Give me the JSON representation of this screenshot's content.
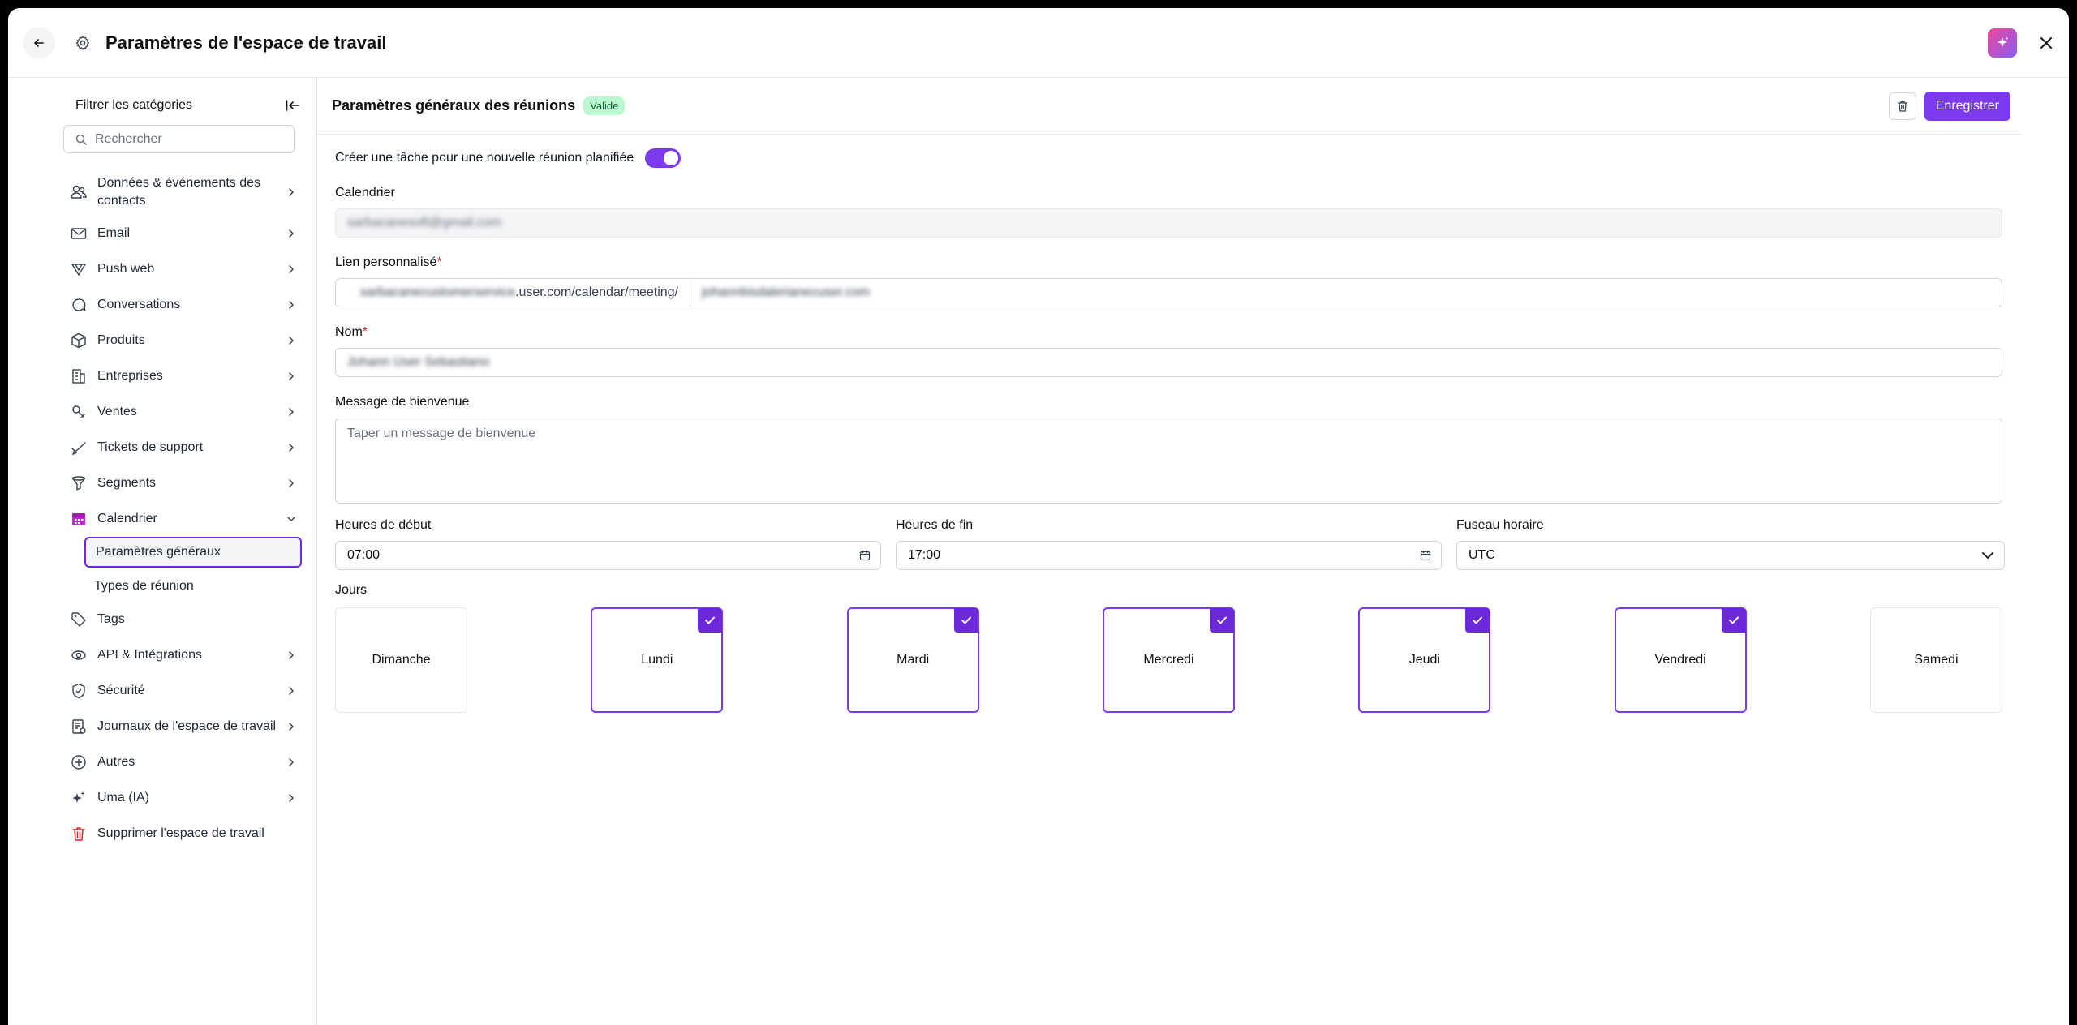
{
  "header": {
    "title": "Paramètres de l'espace de travail"
  },
  "sidebar": {
    "filter_title": "Filtrer les catégories",
    "search_placeholder": "Rechercher",
    "items": [
      {
        "label": "Données & événements des contacts",
        "icon": "contacts-icon"
      },
      {
        "label": "Email",
        "icon": "mail-icon"
      },
      {
        "label": "Push web",
        "icon": "push-icon"
      },
      {
        "label": "Conversations",
        "icon": "chat-icon"
      },
      {
        "label": "Produits",
        "icon": "box-icon"
      },
      {
        "label": "Entreprises",
        "icon": "building-icon"
      },
      {
        "label": "Ventes",
        "icon": "sales-icon"
      },
      {
        "label": "Tickets de support",
        "icon": "ticket-icon"
      },
      {
        "label": "Segments",
        "icon": "filter-icon"
      },
      {
        "label": "Calendrier",
        "icon": "calendar-icon"
      },
      {
        "label": "Tags",
        "icon": "tag-icon"
      },
      {
        "label": "API & Intégrations",
        "icon": "api-icon"
      },
      {
        "label": "Sécurité",
        "icon": "shield-icon"
      },
      {
        "label": "Journaux de l'espace de travail",
        "icon": "log-icon"
      },
      {
        "label": "Autres",
        "icon": "others-icon"
      },
      {
        "label": "Uma (IA)",
        "icon": "sparkle-icon"
      },
      {
        "label": "Supprimer l'espace de travail",
        "icon": "trash-icon"
      }
    ],
    "calendar_sub": [
      "Paramètres généraux",
      "Types de réunion"
    ]
  },
  "main": {
    "title": "Paramètres généraux des réunions",
    "badge": "Valide",
    "save_label": "Enregistrer",
    "toggle_label": "Créer une tâche pour une nouvelle réunion planifiée",
    "toggle_on": true,
    "calendar_label": "Calendrier",
    "calendar_value": "sarbacanesoft@gmail.com",
    "link_label": "Lien personnalisé",
    "link_prefix_hidden": "sarbacanecustomerservice",
    "link_prefix": ".user.com/calendar/meeting/",
    "link_slug": "johannbisdalerianecuser.com",
    "name_label": "Nom",
    "name_value": "Johann User Sebastiano",
    "required_mark": "*",
    "welcome_label": "Message de bienvenue",
    "welcome_placeholder": "Taper un message de bienvenue",
    "start_label": "Heures de début",
    "start_value": "07:00",
    "end_label": "Heures de fin",
    "end_value": "17:00",
    "tz_label": "Fuseau horaire",
    "tz_value": "UTC",
    "days_label": "Jours",
    "days": [
      {
        "label": "Dimanche",
        "on": false
      },
      {
        "label": "Lundi",
        "on": true
      },
      {
        "label": "Mardi",
        "on": true
      },
      {
        "label": "Mercredi",
        "on": true
      },
      {
        "label": "Jeudi",
        "on": true
      },
      {
        "label": "Vendredi",
        "on": true
      },
      {
        "label": "Samedi",
        "on": false
      }
    ]
  },
  "colors": {
    "accent": "#7c3aed",
    "badge_bg": "#bbf7d0",
    "danger": "#dc2626"
  }
}
